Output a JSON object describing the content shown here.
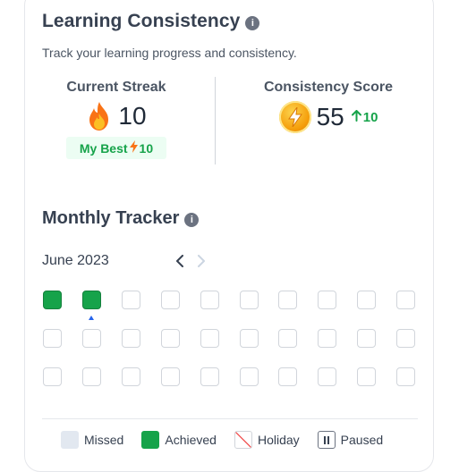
{
  "consistency": {
    "title": "Learning Consistency",
    "subtitle": "Track your learning progress and consistency.",
    "info_icon": "i"
  },
  "streak": {
    "label": "Current Streak",
    "value": "10",
    "best_label": "My Best",
    "best_value": "10",
    "icon": "flame-icon"
  },
  "score": {
    "label": "Consistency Score",
    "value": "55",
    "delta": "10",
    "icon": "bolt-icon",
    "delta_icon": "arrow-up-icon"
  },
  "tracker": {
    "title": "Monthly Tracker",
    "month": "June 2023",
    "rows": [
      [
        "achieved",
        "achieved",
        "empty",
        "empty",
        "empty",
        "empty",
        "empty",
        "empty",
        "empty",
        "empty"
      ],
      [
        "empty",
        "empty",
        "empty",
        "empty",
        "empty",
        "empty",
        "empty",
        "empty",
        "empty",
        "empty"
      ],
      [
        "empty",
        "empty",
        "empty",
        "empty",
        "empty",
        "empty",
        "empty",
        "empty",
        "empty",
        "empty"
      ]
    ],
    "today_index": 1
  },
  "legend": {
    "missed": "Missed",
    "achieved": "Achieved",
    "holiday": "Holiday",
    "paused": "Paused"
  },
  "colors": {
    "achieved": "#16a34a",
    "missed": "#e2e8f0",
    "accent_green": "#16a34a",
    "today_marker": "#2563eb"
  }
}
